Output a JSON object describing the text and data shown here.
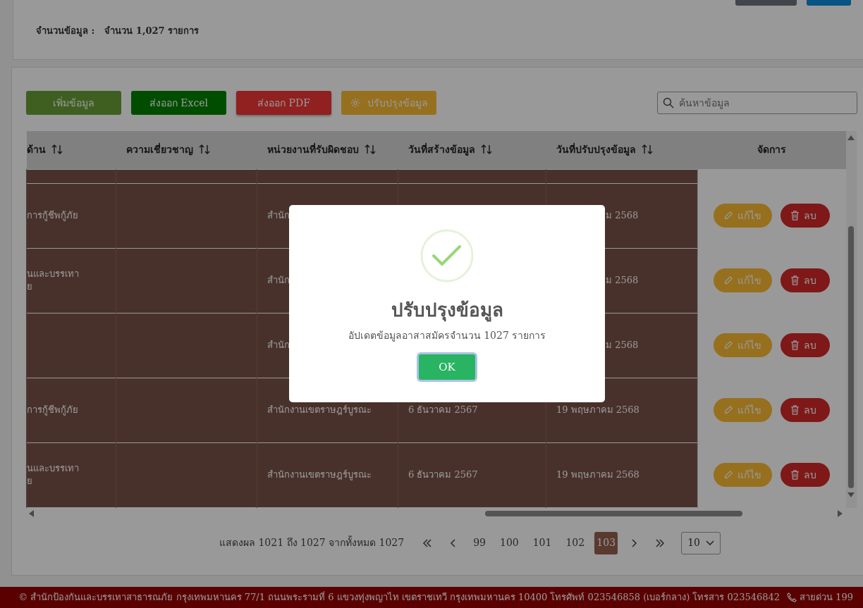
{
  "summary": {
    "label": "จำนวนข้อมูล :",
    "value": "จำนวน 1,027 รายการ"
  },
  "toolbar": [
    {
      "label": "เพิ่มข้อมูล",
      "kind": "add"
    },
    {
      "label": "ส่งออก Excel",
      "kind": "excel"
    },
    {
      "label": "ส่งออก PDF",
      "kind": "pdf"
    },
    {
      "label": "ปรับปรุงข้อมูล",
      "kind": "update"
    }
  ],
  "search": {
    "placeholder": "ค้นหาข้อมูล"
  },
  "table": {
    "columns": [
      {
        "label": "ด้าน",
        "sortable": true
      },
      {
        "label": "ความเชี่ยวชาญ",
        "sortable": true
      },
      {
        "label": "หน่วยงานที่รับผิดชอบ",
        "sortable": true
      },
      {
        "label": "วันที่สร้างข้อมูล",
        "sortable": true
      },
      {
        "label": "วันที่ปรับปรุงข้อมูล",
        "sortable": true
      },
      {
        "label": "จัดการ",
        "sortable": false
      }
    ],
    "rows": [
      {
        "covered": true,
        "cells": [
          [
            "การกู้ชีพกู้ภัย"
          ],
          [],
          [
            "สำนัก"
          ],
          [],
          [
            "ม 2568"
          ]
        ],
        "edit": "แก้ไข",
        "delete": "ลบ"
      },
      {
        "covered": true,
        "cells": [
          [
            "นและบรรเทา",
            "ย"
          ],
          [],
          [
            "สำนัก"
          ],
          [],
          [
            "ม 2568"
          ]
        ],
        "edit": "แก้ไข",
        "delete": "ลบ"
      },
      {
        "covered": true,
        "cells": [
          [],
          [],
          [
            "สำนัก"
          ],
          [],
          [
            "ม 2568"
          ]
        ],
        "edit": "แก้ไข",
        "delete": "ลบ"
      },
      {
        "covered": false,
        "cells": [
          [
            "การกู้ชีพกู้ภัย"
          ],
          [],
          [
            "สำนักงานเขตราษฎร์บูรณะ"
          ],
          [
            "6 ธันวาคม 2567"
          ],
          [
            "19 พฤษภาคม 2568"
          ]
        ],
        "edit": "แก้ไข",
        "delete": "ลบ"
      },
      {
        "covered": false,
        "cells": [
          [
            "นและบรรเทา",
            "ย"
          ],
          [],
          [
            "สำนักงานเขตราษฎร์บูรณะ"
          ],
          [
            "6 ธันวาคม 2567"
          ],
          [
            "19 พฤษภาคม 2568"
          ]
        ],
        "edit": "แก้ไข",
        "delete": "ลบ"
      }
    ]
  },
  "pagination": {
    "info": "แสดงผล 1021 ถึง 1027 จากทั้งหมด 1027",
    "pages": [
      {
        "label": "99",
        "selected": false
      },
      {
        "label": "100",
        "selected": false
      },
      {
        "label": "101",
        "selected": false
      },
      {
        "label": "102",
        "selected": false
      },
      {
        "label": "103",
        "selected": true
      }
    ],
    "page_size": "10"
  },
  "footer": {
    "text": "© สำนักป้องกันและบรรเทาสาธารณภัย กรุงเทพมหานคร 77/1 ถนนพระรามที่ 6 แขวงทุ่งพญาไท เขตราชเทวี กรุงเทพมหานคร 10400 โทรศัพท์ 023546858 (เบอร์กลาง) โทรสาร 023546842",
    "hotline": "สายด่วน 199"
  },
  "dialog": {
    "title": "ปรับปรุงข้อมูล",
    "message": "อัปเดตข้อมูลอาสาสมัครจำนวน 1027 รายการ",
    "button": "OK"
  }
}
